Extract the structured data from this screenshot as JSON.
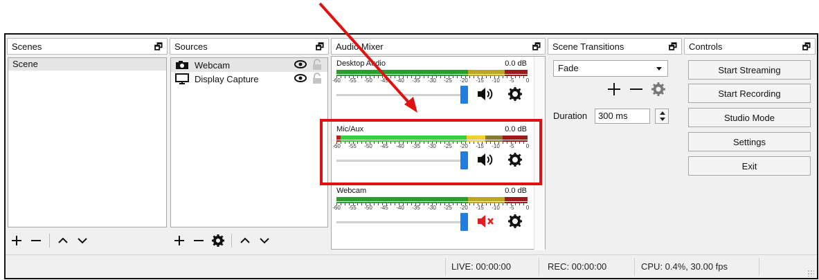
{
  "panels": {
    "scenes": {
      "title": "Scenes",
      "items": [
        "Scene"
      ]
    },
    "sources": {
      "title": "Sources",
      "items": [
        {
          "label": "Webcam",
          "icon": "camera-icon"
        },
        {
          "label": "Display Capture",
          "icon": "monitor-icon"
        }
      ]
    },
    "audio_mixer": {
      "title": "Audio Mixer",
      "scale": [
        "-60",
        "-55",
        "-50",
        "-45",
        "-40",
        "-35",
        "-30",
        "-25",
        "-20",
        "-15",
        "-10",
        "-5",
        "0"
      ],
      "channels": [
        {
          "name": "Desktop Audio",
          "level": "0.0 dB",
          "muted": false
        },
        {
          "name": "Mic/Aux",
          "level": "0.0 dB",
          "muted": false
        },
        {
          "name": "Webcam",
          "level": "0.0 dB",
          "muted": true
        }
      ]
    },
    "scene_transitions": {
      "title": "Scene Transitions",
      "selected": "Fade",
      "duration_label": "Duration",
      "duration_value": "300 ms"
    },
    "controls": {
      "title": "Controls",
      "buttons": [
        "Start Streaming",
        "Start Recording",
        "Studio Mode",
        "Settings",
        "Exit"
      ]
    }
  },
  "status": {
    "live": "LIVE: 00:00:00",
    "rec": "REC: 00:00:00",
    "cpu": "CPU: 0.4%, 30.00 fps"
  },
  "colors": {
    "meter_green": "#2fc12f",
    "meter_yellow": "#d6c22f",
    "meter_red": "#c21b1b",
    "fader_handle": "#1f7fe0",
    "annotation_red": "#e11111"
  }
}
